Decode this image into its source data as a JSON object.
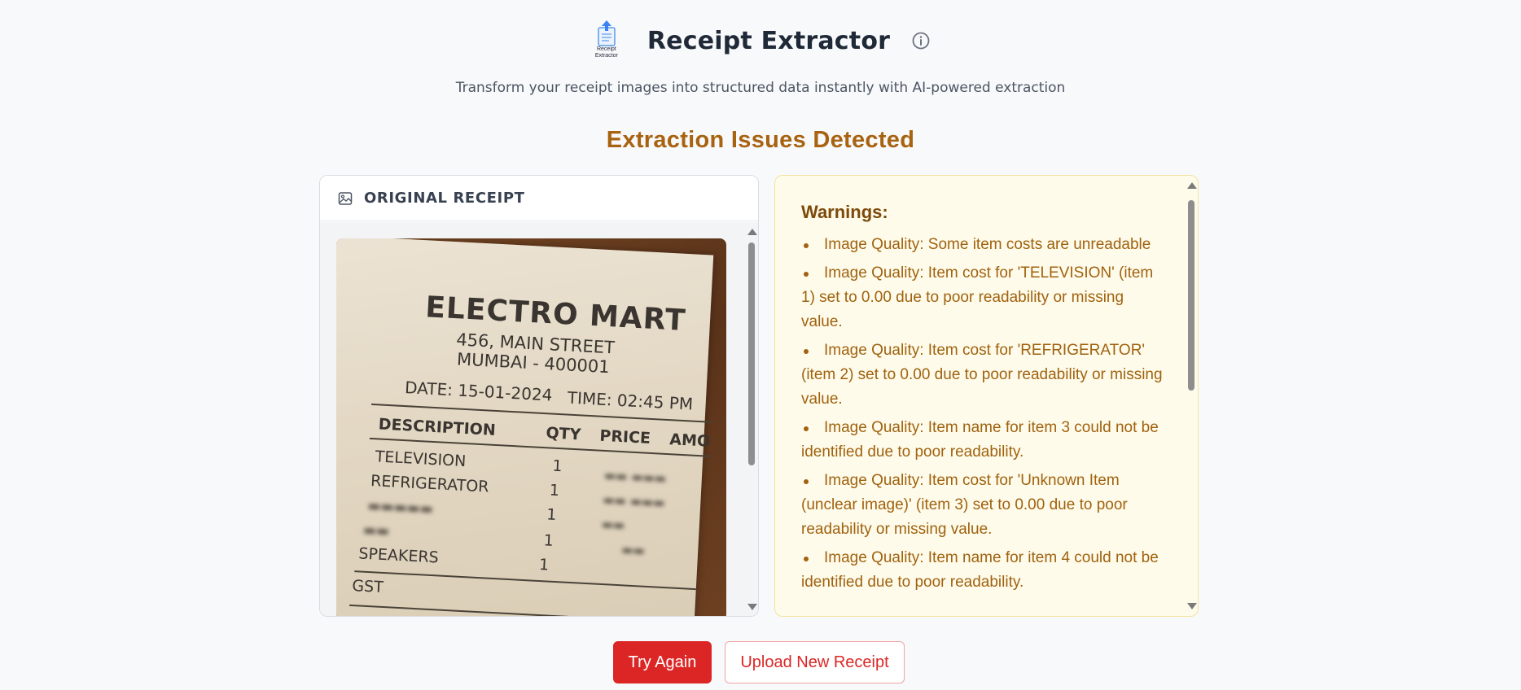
{
  "header": {
    "logo_text": "Receipt Extractor",
    "title": "Receipt Extractor",
    "info_icon": "info-icon"
  },
  "subtitle": "Transform your receipt images into structured data instantly with AI-powered extraction",
  "status_title": "Extraction Issues Detected",
  "receipt_panel": {
    "label": "ORIGINAL RECEIPT",
    "icon": "image-icon",
    "receipt": {
      "store": "ELECTRO MART",
      "address_line1": "456, MAIN STREET",
      "address_line2": "MUMBAI - 400001",
      "date": "DATE: 15-01-2024",
      "time": "TIME: 02:45 PM",
      "col_description": "DESCRIPTION",
      "col_qty": "QTY",
      "col_price": "PRICE",
      "col_amount": "AMO",
      "items": [
        {
          "name": "TELEVISION",
          "qty": "1"
        },
        {
          "name": "REFRIGERATOR",
          "qty": "1"
        },
        {
          "name": "",
          "qty": "1"
        },
        {
          "name": "",
          "qty": "1"
        },
        {
          "name": "SPEAKERS",
          "qty": "1"
        }
      ],
      "gst": "GST"
    }
  },
  "warnings_panel": {
    "title": "Warnings:",
    "items": [
      "Image Quality: Some item costs are unreadable",
      "Image Quality: Item cost for 'TELEVISION' (item 1) set to 0.00 due to poor readability or missing value.",
      "Image Quality: Item cost for 'REFRIGERATOR' (item 2) set to 0.00 due to poor readability or missing value.",
      "Image Quality: Item name for item 3 could not be identified due to poor readability.",
      "Image Quality: Item cost for 'Unknown Item (unclear image)' (item 3) set to 0.00 due to poor readability or missing value.",
      "Image Quality: Item name for item 4 could not be identified due to poor readability."
    ]
  },
  "actions": {
    "try_again": "Try Again",
    "upload_new": "Upload New Receipt"
  },
  "colors": {
    "accent_red": "#dc2626",
    "warning_text": "#a0620f",
    "warning_bg": "#fefbea",
    "title_amber": "#a86311"
  }
}
